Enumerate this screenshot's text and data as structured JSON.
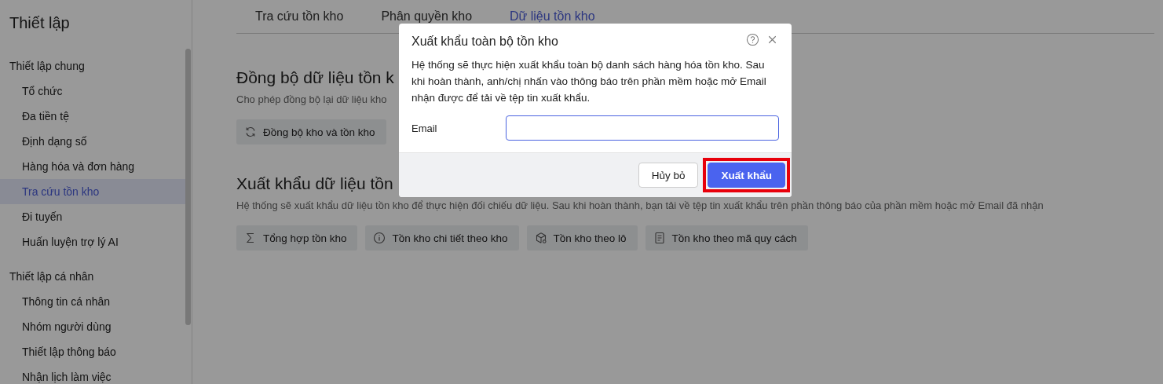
{
  "sidebar": {
    "title": "Thiết lập",
    "groups": [
      {
        "label": "Thiết lập chung",
        "items": [
          {
            "label": "Tổ chức",
            "selected": false
          },
          {
            "label": "Đa tiền tệ",
            "selected": false
          },
          {
            "label": "Định dạng số",
            "selected": false
          },
          {
            "label": "Hàng hóa và đơn hàng",
            "selected": false
          },
          {
            "label": "Tra cứu tồn kho",
            "selected": true
          },
          {
            "label": "Đi tuyến",
            "selected": false
          },
          {
            "label": "Huấn luyện trợ lý AI",
            "selected": false
          }
        ]
      },
      {
        "label": "Thiết lập cá nhân",
        "items": [
          {
            "label": "Thông tin cá nhân",
            "selected": false
          },
          {
            "label": "Nhóm người dùng",
            "selected": false
          },
          {
            "label": "Thiết lập thông báo",
            "selected": false
          },
          {
            "label": "Nhận lịch làm việc",
            "selected": false
          }
        ]
      }
    ]
  },
  "tabs": [
    {
      "label": "Tra cứu tồn kho",
      "selected": false
    },
    {
      "label": "Phân quyền kho",
      "selected": false
    },
    {
      "label": "Dữ liệu tồn kho",
      "selected": true
    }
  ],
  "sections": [
    {
      "title": "Đồng bộ dữ liệu tồn k",
      "description": "Cho phép đồng bộ lại dữ liệu kho",
      "buttons": [
        {
          "label": "Đồng bộ kho và tồn kho",
          "kind": "refresh"
        }
      ]
    },
    {
      "title": "Xuất khẩu dữ liệu tồn",
      "description": "Hệ thống sẽ xuất khẩu dữ liệu tồn kho để thực hiện đối chiếu dữ liệu. Sau khi hoàn thành, bạn tải về tệp tin xuất khẩu trên phần thông báo của phần mềm hoặc mở Email đã nhận",
      "buttons": [
        {
          "label": "Tổng hợp tồn kho",
          "kind": "sigma"
        },
        {
          "label": "Tồn kho chi tiết theo kho",
          "kind": "info"
        },
        {
          "label": "Tồn kho theo lô",
          "kind": "box"
        },
        {
          "label": "Tồn kho theo mã quy cách",
          "kind": "document"
        }
      ]
    }
  ],
  "dialog": {
    "title": "Xuất khẩu toàn bộ tồn kho",
    "message": "Hệ thống sẽ thực hiện xuất khẩu toàn bộ danh sách hàng hóa tồn kho. Sau khi hoàn thành, anh/chị nhấn vào thông báo trên phần mềm hoặc mở Email nhận được để tải về tệp tin xuất khẩu.",
    "field": {
      "label": "Email",
      "focused": true
    },
    "buttons": [
      {
        "label": "Hủy bỏ",
        "kind": "secondary",
        "highlighted": false
      },
      {
        "label": "Xuất khẩu",
        "kind": "primary",
        "highlighted": true
      }
    ]
  }
}
